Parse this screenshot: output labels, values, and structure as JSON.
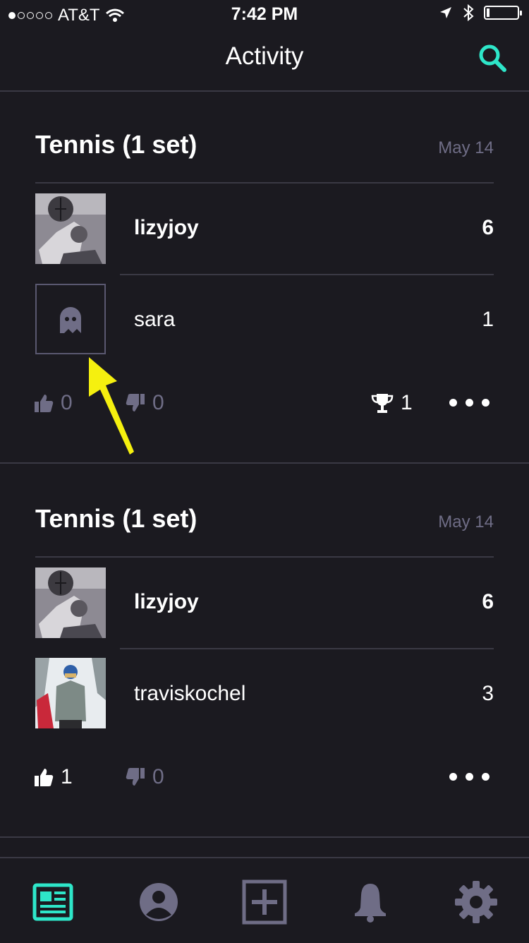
{
  "status_bar": {
    "carrier": "AT&T",
    "time": "7:42 PM"
  },
  "nav": {
    "title": "Activity",
    "search_icon": "search-icon"
  },
  "feed": [
    {
      "title": "Tennis (1 set)",
      "date": "May 14",
      "players": [
        {
          "name": "lizyjoy",
          "score": "6",
          "winner": true,
          "avatar": "photo"
        },
        {
          "name": "sara",
          "score": "1",
          "winner": false,
          "avatar": "ghost-icon"
        }
      ],
      "likes": "0",
      "dislikes": "0",
      "trophies": "1"
    },
    {
      "title": "Tennis (1 set)",
      "date": "May 14",
      "players": [
        {
          "name": "lizyjoy",
          "score": "6",
          "winner": true,
          "avatar": "photo"
        },
        {
          "name": "traviskochel",
          "score": "3",
          "winner": false,
          "avatar": "photo"
        }
      ],
      "likes": "1",
      "dislikes": "0"
    }
  ],
  "tabs": [
    "feed-icon",
    "profile-icon",
    "add-icon",
    "bell-icon",
    "gear-icon"
  ],
  "colors": {
    "accent": "#2ee6c9",
    "muted": "#6f6d86",
    "background": "#1b1a20"
  }
}
